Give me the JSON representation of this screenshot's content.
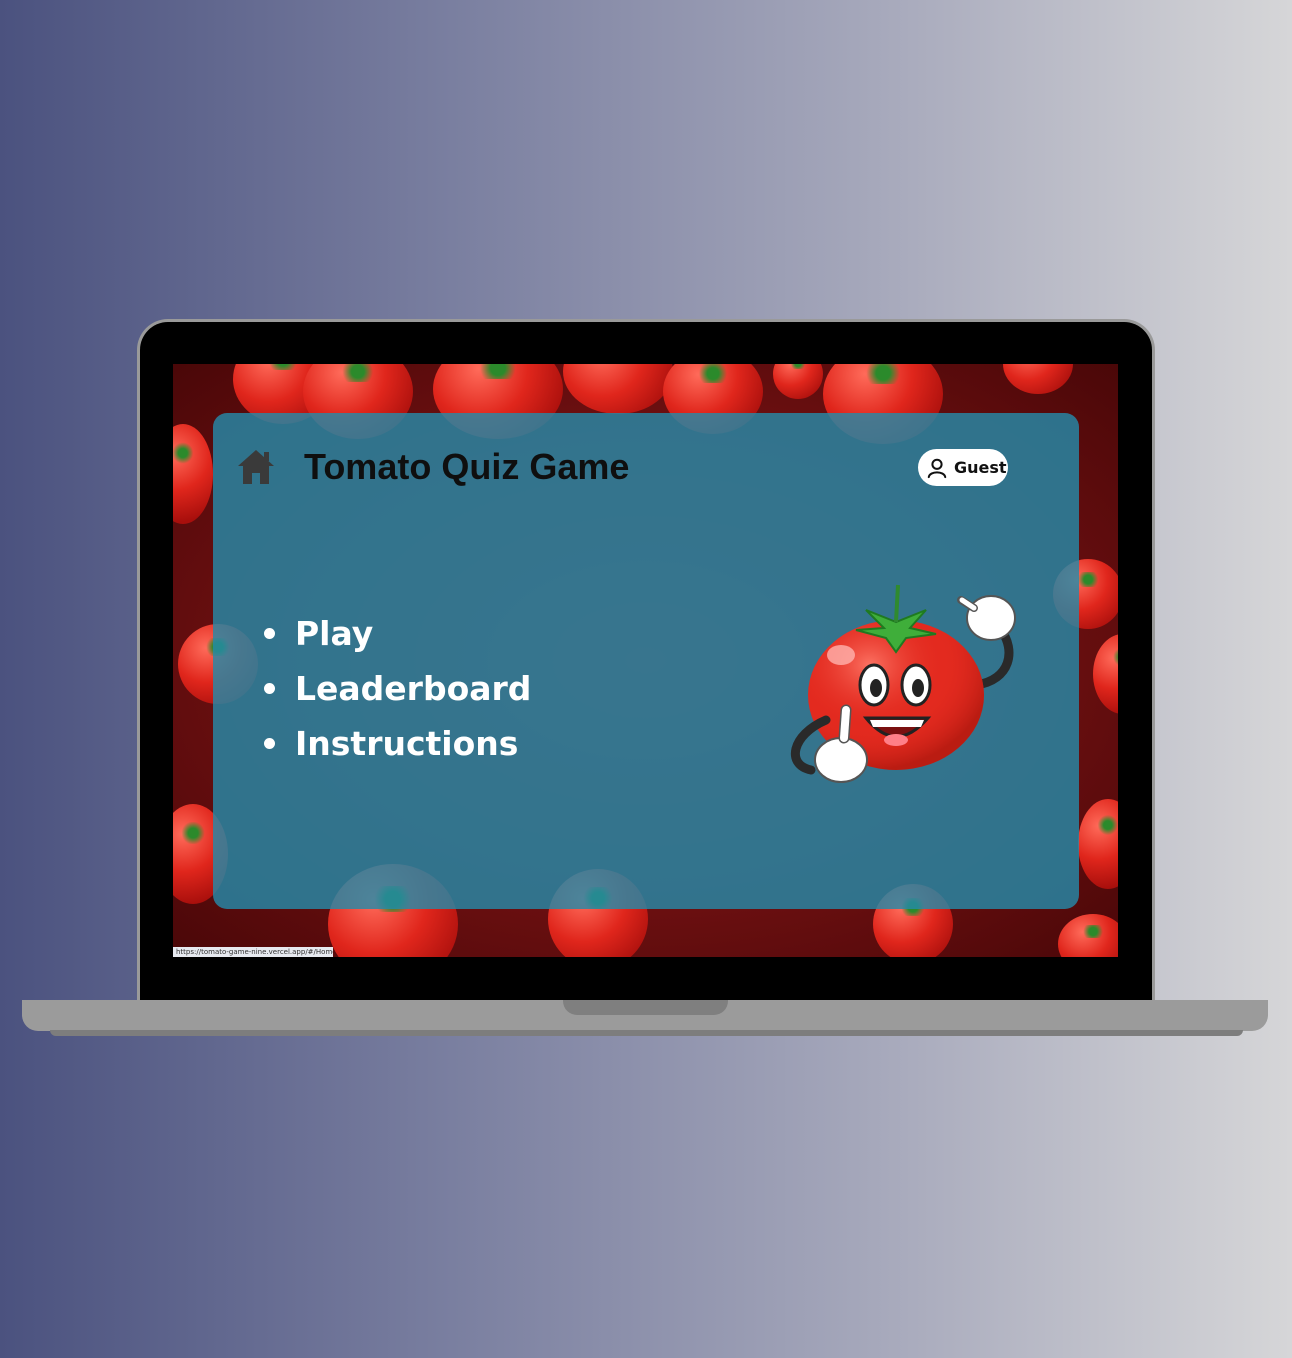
{
  "header": {
    "home_icon": "home-icon",
    "title": "Tomato Quiz Game",
    "user_icon": "user-icon",
    "user_label": "Guest"
  },
  "menu": {
    "items": [
      {
        "label": "Play"
      },
      {
        "label": "Leaderboard"
      },
      {
        "label": "Instructions"
      }
    ]
  },
  "mascot": {
    "icon": "tomato-mascot"
  },
  "status_bar": {
    "url": "https://tomato-game-nine.vercel.app/#/Home"
  },
  "colors": {
    "panel": "#268aa8",
    "background_red": "#7a1212",
    "tomato": "#e0261c",
    "text_white": "#ffffff",
    "title_dark": "#0f0f0f"
  }
}
